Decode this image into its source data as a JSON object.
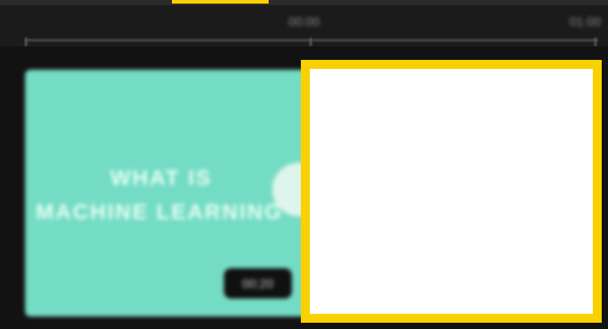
{
  "colors": {
    "accent": "#f9d100",
    "clip_background": "#74dcc4",
    "page_background": "#161616"
  },
  "ruler": {
    "tick_labels": [
      "00:00",
      "01:00"
    ]
  },
  "clip": {
    "title_line_1": "WHAT IS",
    "title_line_2": "MACHINE LEARNING",
    "duration": "00:20",
    "play_icon": "play-icon"
  }
}
